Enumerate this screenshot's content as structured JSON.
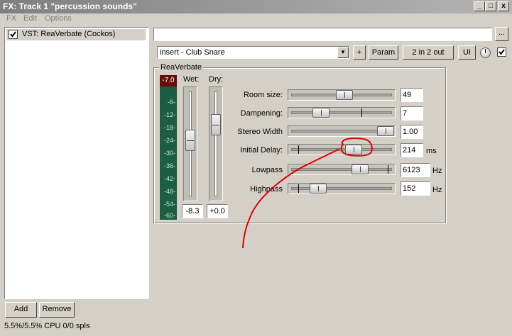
{
  "window": {
    "title": "FX: Track 1 \"percussion sounds\"",
    "minimize": "_",
    "maximize": "□",
    "close": "x"
  },
  "menu": [
    "FX",
    "Edit",
    "Options"
  ],
  "fx_list": {
    "items": [
      {
        "label": "VST: ReaVerbate (Cockos)",
        "checked": true
      }
    ],
    "add_label": "Add",
    "remove_label": "Remove"
  },
  "status": {
    "cpu": "5.5%/5.5% CPU 0/0 spls"
  },
  "toolbar": {
    "preset_name": "",
    "browse_label": "...",
    "preset_select": "insert - Club Snare",
    "plus_label": "+",
    "param_label": "Param",
    "io_label": "2 in 2 out",
    "ui_label": "UI"
  },
  "plugin": {
    "name": "ReaVerbate",
    "meter": {
      "peak": "-7.0",
      "ticks": [
        "-6-",
        "-12-",
        "-18-",
        "-24-",
        "-30-",
        "-36-",
        "-42-",
        "-48-",
        "-54-",
        "-60-"
      ]
    },
    "wet": {
      "label": "Wet:",
      "value": "-8.3"
    },
    "dry": {
      "label": "Dry:",
      "value": "+0.0"
    },
    "params": [
      {
        "label": "Room size:",
        "value": "49",
        "unit": ""
      },
      {
        "label": "Dampening:",
        "value": "7",
        "unit": ""
      },
      {
        "label": "Stereo Width",
        "value": "1.00",
        "unit": ""
      },
      {
        "label": "Initial Delay:",
        "value": "214",
        "unit": "ms"
      },
      {
        "label": "Lowpass",
        "value": "6123",
        "unit": "Hz"
      },
      {
        "label": "Highpass",
        "value": "152",
        "unit": "Hz"
      }
    ]
  },
  "colors": {
    "annotation": "#e00000",
    "meter_bg": "#1c5e44",
    "meter_peak": "#6b0a0a"
  }
}
